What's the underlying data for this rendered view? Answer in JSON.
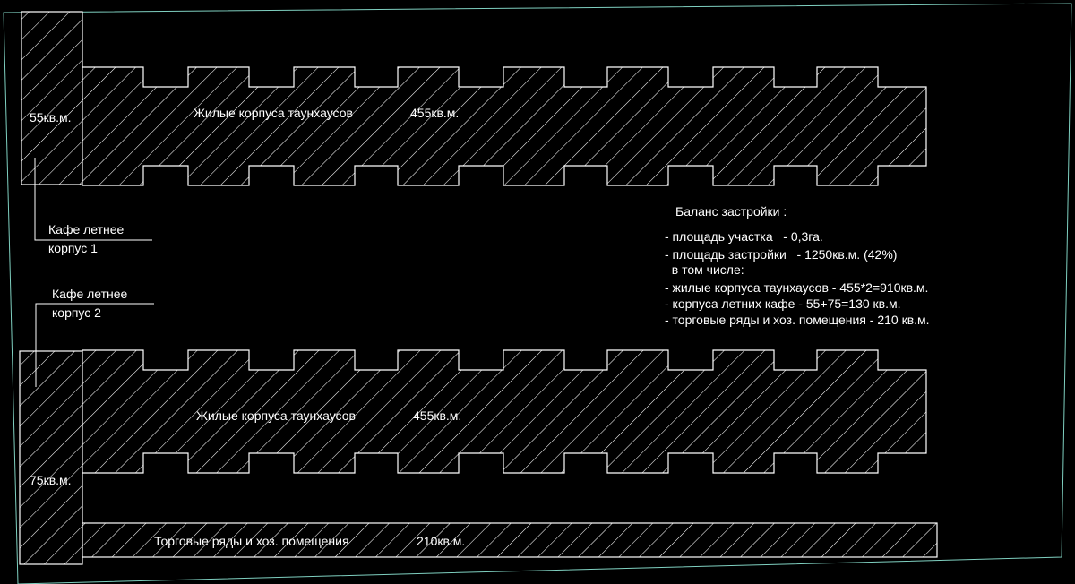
{
  "colors": {
    "background": "#000000",
    "linework": "#ffffff",
    "site_boundary": "#7fd0c0"
  },
  "buildings": {
    "townhouses_top": {
      "name": "Жилые корпуса таунхаусов",
      "area": "455кв.м."
    },
    "townhouses_bottom": {
      "name": "Жилые корпуса таунхаусов",
      "area": "455кв.м."
    },
    "cafe_1": {
      "area": "55кв.м.",
      "label_line1": "Кафе летнее",
      "label_line2": "корпус 1"
    },
    "cafe_2": {
      "area": "75кв.м.",
      "label_line1": "Кафе летнее",
      "label_line2": "корпус 2"
    },
    "trade_rows": {
      "name": "Торговые ряды и хоз. помещения",
      "area": "210кв.м."
    }
  },
  "balance": {
    "title": "Баланс застройки :",
    "lines": [
      "- площадь участка   - 0,3га.",
      "- площадь застройки   - 1250кв.м. (42%)",
      "  в том числе:",
      "- жилые корпуса таунхаусов - 455*2=910кв.м.",
      "- корпуса летних кафе - 55+75=130 кв.м.",
      "- торговые ряды и хоз. помещения - 210 кв.м."
    ]
  }
}
